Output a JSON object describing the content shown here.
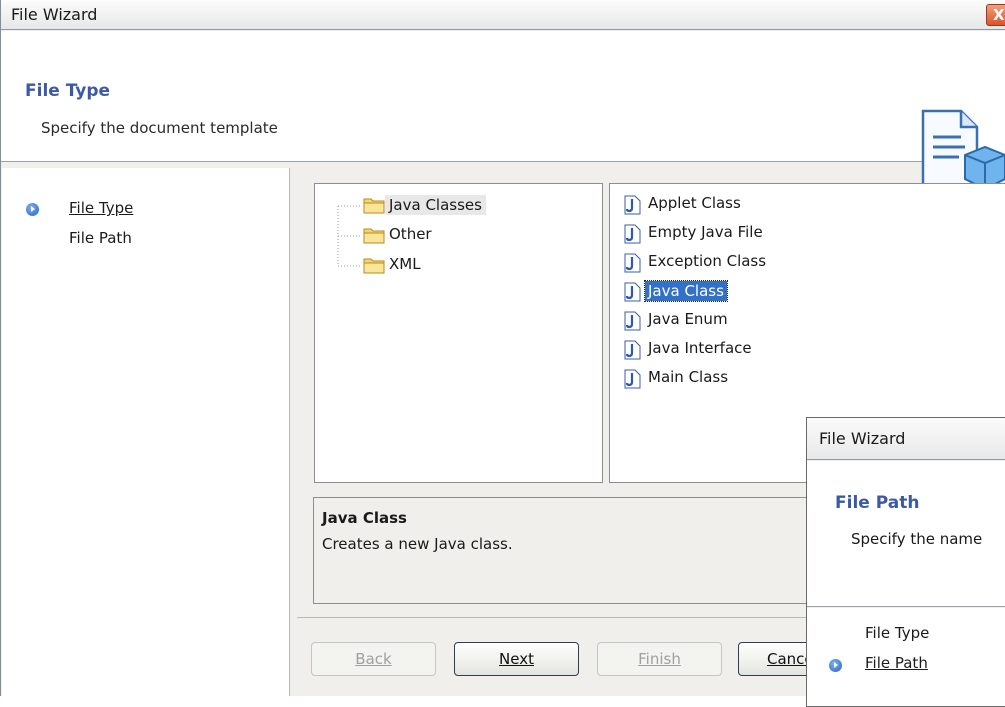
{
  "window": {
    "title": "File Wizard",
    "close_glyph": "X"
  },
  "header": {
    "title": "File Type",
    "subtitle": "Specify the document template",
    "icon": "document-template-icon"
  },
  "steps": [
    {
      "label": "File Type",
      "current": true
    },
    {
      "label": "File Path",
      "current": false
    }
  ],
  "categories": [
    {
      "label": "Java Classes",
      "selected": true
    },
    {
      "label": "Other",
      "selected": false
    },
    {
      "label": "XML",
      "selected": false
    }
  ],
  "templates": [
    {
      "label": "Applet Class"
    },
    {
      "label": "Empty Java File"
    },
    {
      "label": "Exception Class"
    },
    {
      "label": "Java Class",
      "selected": true
    },
    {
      "label": "Java Enum"
    },
    {
      "label": "Java Interface"
    },
    {
      "label": "Main Class"
    }
  ],
  "description": {
    "title": "Java Class",
    "text": "Creates a new Java class."
  },
  "buttons": {
    "back": "Back",
    "next": "Next",
    "finish": "Finish",
    "cancel": "Cance"
  },
  "second_window": {
    "title": "File Wizard",
    "header_title": "File Path",
    "header_subtitle": "Specify the name",
    "steps": [
      {
        "label": "File Type",
        "current": false
      },
      {
        "label": "File Path",
        "current": true
      }
    ]
  },
  "colors": {
    "accent": "#3b59a6",
    "selection": "#3270c9",
    "chrome": "#f0efeb"
  }
}
